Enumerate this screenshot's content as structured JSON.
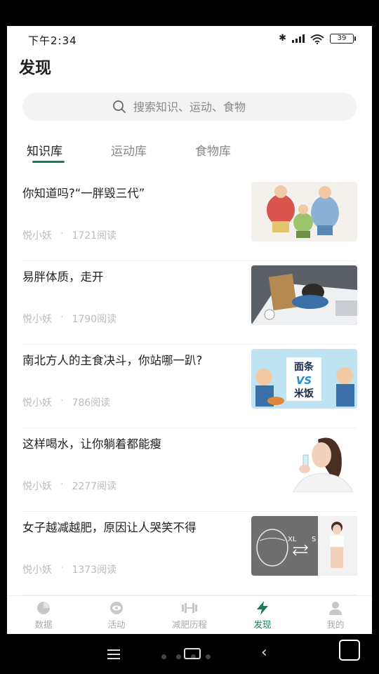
{
  "status": {
    "time": "下午2:34",
    "battery": "39"
  },
  "page": {
    "title": "发现"
  },
  "search": {
    "placeholder": "搜索知识、运动、食物"
  },
  "tabs": [
    {
      "label": "知识库",
      "active": true
    },
    {
      "label": "运动库",
      "active": false
    },
    {
      "label": "食物库",
      "active": false
    }
  ],
  "articles": [
    {
      "title": "你知道吗?“一胖毁三代”",
      "author": "悦小妖",
      "reads": "1721阅读",
      "thumb": "overweight-family-cartoon"
    },
    {
      "title": "易胖体质，走开",
      "author": "悦小妖",
      "reads": "1790阅读",
      "thumb": "tired-person-at-desk"
    },
    {
      "title": "南北方人的主食决斗，你站哪一趴?",
      "author": "悦小妖",
      "reads": "786阅读",
      "thumb": "noodles-vs-rice",
      "thumb_text": [
        "面条",
        "VS",
        "米饭"
      ]
    },
    {
      "title": "这样喝水，让你躺着都能瘦",
      "author": "悦小妖",
      "reads": "2277阅读",
      "thumb": "woman-drinking-water"
    },
    {
      "title": "女子越减越肥，原因让人哭笑不得",
      "author": "悦小妖",
      "reads": "1373阅读",
      "thumb": "waist-xl-to-s",
      "thumb_text": [
        "XL",
        "S"
      ]
    }
  ],
  "tabbar": [
    {
      "label": "数据",
      "icon": "pie-chart-icon",
      "active": false
    },
    {
      "label": "活动",
      "icon": "eye-circle-icon",
      "active": false
    },
    {
      "label": "减肥历程",
      "icon": "dumbbell-icon",
      "active": false
    },
    {
      "label": "发现",
      "icon": "lightning-icon",
      "active": true
    },
    {
      "label": "我的",
      "icon": "person-icon",
      "active": false
    }
  ],
  "colors": {
    "accent": "#1f7a5a",
    "text": "#222222",
    "muted": "#bbbbbb"
  }
}
